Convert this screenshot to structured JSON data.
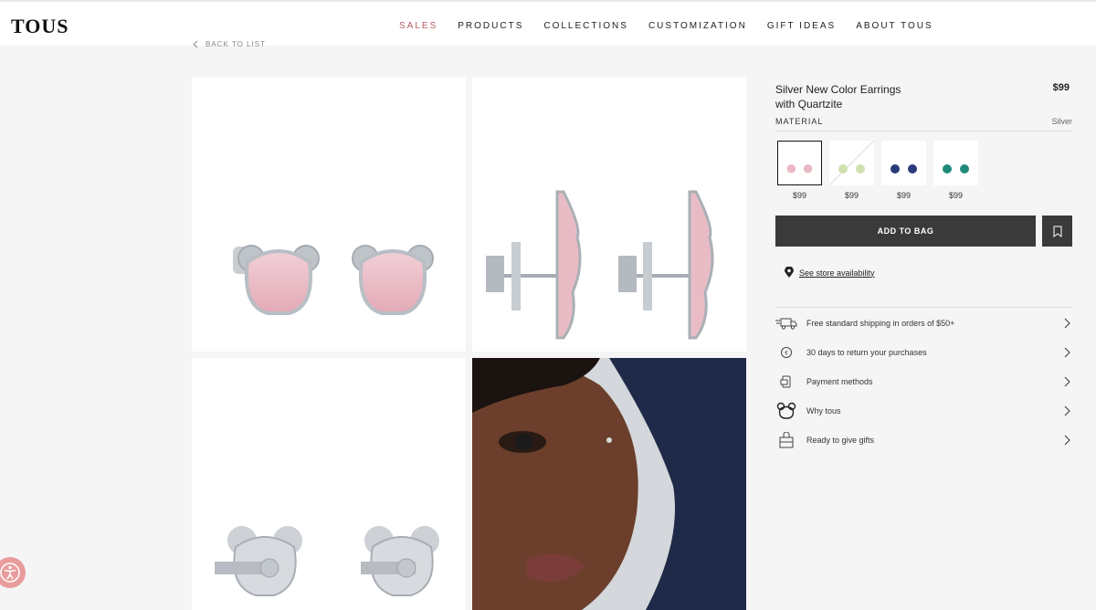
{
  "header": {
    "logo": "TOUS",
    "nav": [
      "SALES",
      "PRODUCTS",
      "COLLECTIONS",
      "CUSTOMIZATION",
      "GIFT IDEAS",
      "ABOUT TOUS"
    ]
  },
  "back_label": "BACK TO LIST",
  "product": {
    "title_line1": "Silver New Color Earrings",
    "title_line2": "with Quartzite",
    "price": "$99",
    "material_label": "MATERIAL",
    "material_value": "Silver",
    "variants": [
      {
        "price": "$99",
        "color": "#e9b9c2"
      },
      {
        "price": "$99",
        "color": "#cfe0b0"
      },
      {
        "price": "$99",
        "color": "#2a3a7a"
      },
      {
        "price": "$99",
        "color": "#1f8a78"
      }
    ],
    "add_to_bag": "ADD TO BAG",
    "store_link": "See store availability"
  },
  "info_rows": [
    {
      "icon": "truck-icon",
      "text": "Free standard shipping in orders of $50+"
    },
    {
      "icon": "return-icon",
      "text": "30 days to return your purchases"
    },
    {
      "icon": "payment-icon",
      "text": "Payment methods"
    },
    {
      "icon": "bear-icon",
      "text": "Why tous"
    },
    {
      "icon": "gift-bag-icon",
      "text": "Ready to give gifts"
    }
  ],
  "colors": {
    "accent": "#b5575e",
    "button": "#3a3a3a",
    "accessibility": "#e99c9c"
  }
}
